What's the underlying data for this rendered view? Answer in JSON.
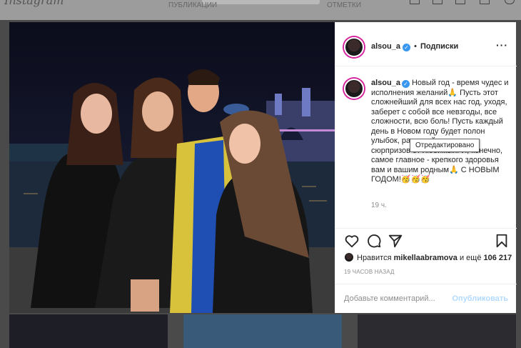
{
  "background": {
    "top_tabs": [
      "ПУБЛИКАЦИИ",
      "ОТМЕТКИ"
    ]
  },
  "header": {
    "username": "alsou_a",
    "verified_icon": "verified-badge-icon",
    "separator": "•",
    "follow_label": "Подписки",
    "more_icon": "more-options-icon"
  },
  "caption": {
    "username": "alsou_a",
    "text": "Новый год - время чудес и исполнения желаний🙏 Пусть этот сложнейший для всех нас год, уходя, заберет с собой все невзгоды, все сложности, всю боль! Пусть каждый день в Новом году будет полон улыбок, радостей, приятных сюрпризов от любимых. И, конечно, самое главное - крепкого здоровья вам и вашим родным🙏 С НОВЫМ ГОДОМ!🥳🥳🥳",
    "relative_time": "19 ч."
  },
  "tooltip": {
    "text": "Отредактировано"
  },
  "actions": {
    "like_icon": "heart-icon",
    "comment_icon": "comment-icon",
    "share_icon": "share-icon",
    "save_icon": "bookmark-icon"
  },
  "likes": {
    "prefix": "Нравится",
    "user": "mikellaabramova",
    "middle": "и ещё",
    "count": "106 217"
  },
  "posted_ago": "19 ЧАСОВ НАЗАД",
  "comment": {
    "placeholder": "Добавьте комментарий...",
    "publish_label": "Опубликовать"
  },
  "colors": {
    "accent": "#3897f0",
    "publish_disabled": "#b3dbff",
    "ring": "#d6249f"
  }
}
